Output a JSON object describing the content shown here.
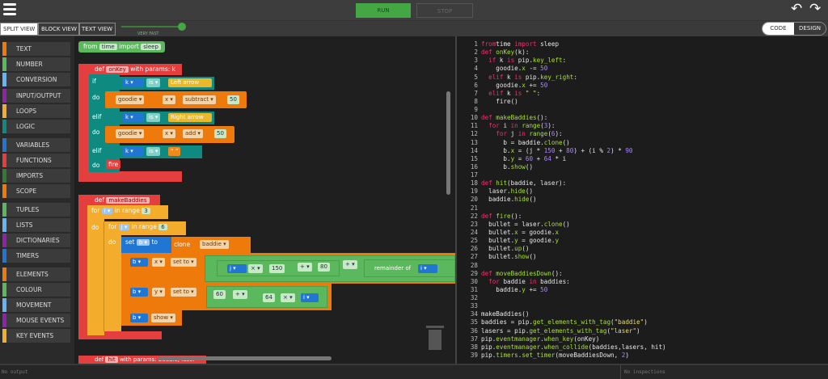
{
  "toolbar": {
    "run": "RUN",
    "stop": "STOP",
    "undo_icon": "undo-icon",
    "redo_icon": "redo-icon",
    "menu_icon": "hamburger-menu-icon"
  },
  "views": {
    "split": "SPLIT VIEW",
    "block": "BLOCK VIEW",
    "text": "TEXT VIEW",
    "speed_label": "VERY FAST",
    "speed_level": 1.0,
    "active": "SPLIT VIEW"
  },
  "mode": {
    "code": "CODE",
    "design": "DESIGN",
    "active": "CODE"
  },
  "palette": [
    {
      "label": "TEXT",
      "color": "#ef7a0c"
    },
    {
      "label": "NUMBER",
      "color": "#5cb85c"
    },
    {
      "label": "CONVERSION",
      "color": "#64b5f6"
    },
    {
      "label": "INPUT/OUTPUT",
      "color": "#8e24aa"
    },
    {
      "label": "LOOPS",
      "color": "#f4ac2c"
    },
    {
      "label": "LOGIC",
      "color": "#0e8a80"
    },
    {
      "label": "VARIABLES",
      "color": "#2076d2"
    },
    {
      "label": "FUNCTIONS",
      "color": "#e53e3e"
    },
    {
      "label": "IMPORTS",
      "color": "#2e7d32"
    },
    {
      "label": "SCOPE",
      "color": "#ef7a0c"
    },
    {
      "label": "TUPLES",
      "color": "#5cb85c"
    },
    {
      "label": "LISTS",
      "color": "#64b5f6"
    },
    {
      "label": "DICTIONARIES",
      "color": "#8e24aa"
    },
    {
      "label": "TIMERS",
      "color": "#2076d2"
    },
    {
      "label": "ELEMENTS",
      "color": "#ef7a0c"
    },
    {
      "label": "COLOUR",
      "color": "#5cb85c"
    },
    {
      "label": "MOVEMENT",
      "color": "#64b5f6"
    },
    {
      "label": "MOUSE EVENTS",
      "color": "#8e24aa"
    },
    {
      "label": "KEY EVENTS",
      "color": "#f4ac2c"
    }
  ],
  "blocks": {
    "imp": {
      "from": "from",
      "mod": "time",
      "import": "import",
      "name": "sleep"
    },
    "onkey": {
      "def": "def",
      "name": "onKey",
      "params": "with params: k",
      "if": "if",
      "do": "do",
      "elif": "elif",
      "k": "k ▾",
      "is": "is ▾",
      "left": "Left arrow",
      "right": "Right arrow",
      "space": "“ ”",
      "goodie": "goodie ▾",
      "x": "x ▾",
      "subtract": "subtract ▾",
      "add": "add ▾",
      "n50": "50",
      "fire": "fire"
    },
    "mk": {
      "def": "def",
      "name": "makeBaddies",
      "for": "for",
      "i": "i ▾",
      "j": "j ▾",
      "inrange": "in range",
      "n3": "3",
      "n6": "6",
      "do": "do",
      "set": "set",
      "b": "b ▾",
      "to": "to",
      "clone": "clone",
      "baddie": "baddie ▾",
      "x": "x ▾",
      "y": "y ▾",
      "setto": "set to ▾",
      "times": "× ▾",
      "plus": "+ ▾",
      "n150": "150",
      "n80": "80",
      "remainder": "remainder of",
      "n60": "60",
      "n64": "64",
      "show": "show ▾"
    },
    "hit": {
      "def": "def",
      "name": "hit",
      "params": "with params: baddie, laser"
    }
  },
  "code_lines": [
    [
      [
        "kw",
        "from"
      ],
      [
        "",
        "time "
      ],
      [
        "kw",
        "import"
      ],
      [
        "",
        " sleep"
      ]
    ],
    [
      [
        "kw",
        "def "
      ],
      [
        "fn",
        "onKey"
      ],
      [
        "",
        "(k):"
      ]
    ],
    [
      [
        "",
        "  "
      ],
      [
        "kw",
        "if"
      ],
      [
        "",
        " k "
      ],
      [
        "kw",
        "is"
      ],
      [
        "",
        " pip."
      ],
      [
        "fn",
        "key_left"
      ],
      [
        "",
        ":"
      ]
    ],
    [
      [
        "",
        "    goodie."
      ],
      [
        "fn",
        "x"
      ],
      [
        "",
        " -= "
      ],
      [
        "num",
        "50"
      ]
    ],
    [
      [
        "",
        "  "
      ],
      [
        "kw",
        "elif"
      ],
      [
        "",
        " k "
      ],
      [
        "kw",
        "is"
      ],
      [
        "",
        " pip."
      ],
      [
        "fn",
        "key_right"
      ],
      [
        "",
        ":"
      ]
    ],
    [
      [
        "",
        "    goodie."
      ],
      [
        "fn",
        "x"
      ],
      [
        "",
        " += "
      ],
      [
        "num",
        "50"
      ]
    ],
    [
      [
        "",
        "  "
      ],
      [
        "kw",
        "elif"
      ],
      [
        "",
        " k "
      ],
      [
        "kw",
        "is"
      ],
      [
        "str",
        " \" \""
      ],
      [
        "",
        ":"
      ]
    ],
    [
      [
        "",
        "    fire()"
      ]
    ],
    [
      [
        "",
        ""
      ]
    ],
    [
      [
        "kw",
        "def "
      ],
      [
        "fn",
        "makeBaddies"
      ],
      [
        "",
        "():"
      ]
    ],
    [
      [
        "",
        "  "
      ],
      [
        "kw",
        "for"
      ],
      [
        "",
        " i "
      ],
      [
        "kw",
        "in"
      ],
      [
        "fn",
        " range"
      ],
      [
        "",
        "("
      ],
      [
        "num",
        "3"
      ],
      [
        "",
        "):"
      ]
    ],
    [
      [
        "",
        "    "
      ],
      [
        "kw",
        "for"
      ],
      [
        "",
        " j "
      ],
      [
        "kw",
        "in"
      ],
      [
        "fn",
        " range"
      ],
      [
        "",
        "("
      ],
      [
        "num",
        "6"
      ],
      [
        "",
        "):"
      ]
    ],
    [
      [
        "",
        "      b = baddie."
      ],
      [
        "fn",
        "clone"
      ],
      [
        "",
        "()"
      ]
    ],
    [
      [
        "",
        "      b."
      ],
      [
        "fn",
        "x"
      ],
      [
        "",
        " = (j * "
      ],
      [
        "num",
        "150"
      ],
      [
        "",
        " + "
      ],
      [
        "num",
        "80"
      ],
      [
        "",
        ") + (i % "
      ],
      [
        "num",
        "2"
      ],
      [
        "",
        ") * "
      ],
      [
        "num",
        "90"
      ]
    ],
    [
      [
        "",
        "      b."
      ],
      [
        "fn",
        "y"
      ],
      [
        "",
        " = "
      ],
      [
        "num",
        "60"
      ],
      [
        "",
        " + "
      ],
      [
        "num",
        "64"
      ],
      [
        "",
        " * i"
      ]
    ],
    [
      [
        "",
        "      b."
      ],
      [
        "fn",
        "show"
      ],
      [
        "",
        "()"
      ]
    ],
    [
      [
        "",
        ""
      ]
    ],
    [
      [
        "kw",
        "def "
      ],
      [
        "fn",
        "hit"
      ],
      [
        "",
        "(baddie, laser):"
      ]
    ],
    [
      [
        "",
        "  laser."
      ],
      [
        "fn",
        "hide"
      ],
      [
        "",
        "()"
      ]
    ],
    [
      [
        "",
        "  baddie."
      ],
      [
        "fn",
        "hide"
      ],
      [
        "",
        "()"
      ]
    ],
    [
      [
        "",
        ""
      ]
    ],
    [
      [
        "kw",
        "def "
      ],
      [
        "fn",
        "fire"
      ],
      [
        "",
        "():"
      ]
    ],
    [
      [
        "",
        "  bullet = laser."
      ],
      [
        "fn",
        "clone"
      ],
      [
        "",
        "()"
      ]
    ],
    [
      [
        "",
        "  bullet."
      ],
      [
        "fn",
        "x"
      ],
      [
        "",
        " = goodie."
      ],
      [
        "fn",
        "x"
      ]
    ],
    [
      [
        "",
        "  bullet."
      ],
      [
        "fn",
        "y"
      ],
      [
        "",
        " = goodie."
      ],
      [
        "fn",
        "y"
      ]
    ],
    [
      [
        "",
        "  bullet."
      ],
      [
        "fn",
        "up"
      ],
      [
        "",
        "()"
      ]
    ],
    [
      [
        "",
        "  bullet."
      ],
      [
        "fn",
        "show"
      ],
      [
        "",
        "()"
      ]
    ],
    [
      [
        "",
        ""
      ]
    ],
    [
      [
        "kw",
        "def "
      ],
      [
        "fn",
        "moveBaddiesDown"
      ],
      [
        "",
        "():"
      ]
    ],
    [
      [
        "",
        "  "
      ],
      [
        "kw",
        "for"
      ],
      [
        "",
        " baddie "
      ],
      [
        "kw",
        "in"
      ],
      [
        "",
        " baddies:"
      ]
    ],
    [
      [
        "",
        "    baddie."
      ],
      [
        "fn",
        "y"
      ],
      [
        "",
        " += "
      ],
      [
        "num",
        "50"
      ]
    ],
    [
      [
        "",
        ""
      ]
    ],
    [
      [
        "",
        ""
      ]
    ],
    [
      [
        "",
        "makeBaddies()"
      ]
    ],
    [
      [
        "",
        "baddies = pip."
      ],
      [
        "fn",
        "get_elements_with_tag"
      ],
      [
        "",
        "("
      ],
      [
        "str",
        "\"baddie\""
      ],
      [
        "",
        ")"
      ]
    ],
    [
      [
        "",
        "lasers = pip."
      ],
      [
        "fn",
        "get_elements_with_tag"
      ],
      [
        "",
        "("
      ],
      [
        "str",
        "\"laser\""
      ],
      [
        "",
        ")"
      ]
    ],
    [
      [
        "",
        "pip."
      ],
      [
        "fn",
        "eventmanager"
      ],
      [
        "",
        "."
      ],
      [
        "fn",
        "when_key"
      ],
      [
        "",
        "(onKey)"
      ]
    ],
    [
      [
        "",
        "pip."
      ],
      [
        "fn",
        "eventmanager"
      ],
      [
        "",
        "."
      ],
      [
        "fn",
        "when_collide"
      ],
      [
        "",
        "(baddies,lasers, hit)"
      ]
    ],
    [
      [
        "",
        "pip."
      ],
      [
        "fn",
        "timers"
      ],
      [
        "",
        "."
      ],
      [
        "fn",
        "set_timer"
      ],
      [
        "",
        "(moveBaddiesDown, "
      ],
      [
        "num",
        "2"
      ],
      [
        "",
        ")"
      ]
    ]
  ],
  "status": {
    "output": "No output",
    "inspections": "No inspections"
  }
}
